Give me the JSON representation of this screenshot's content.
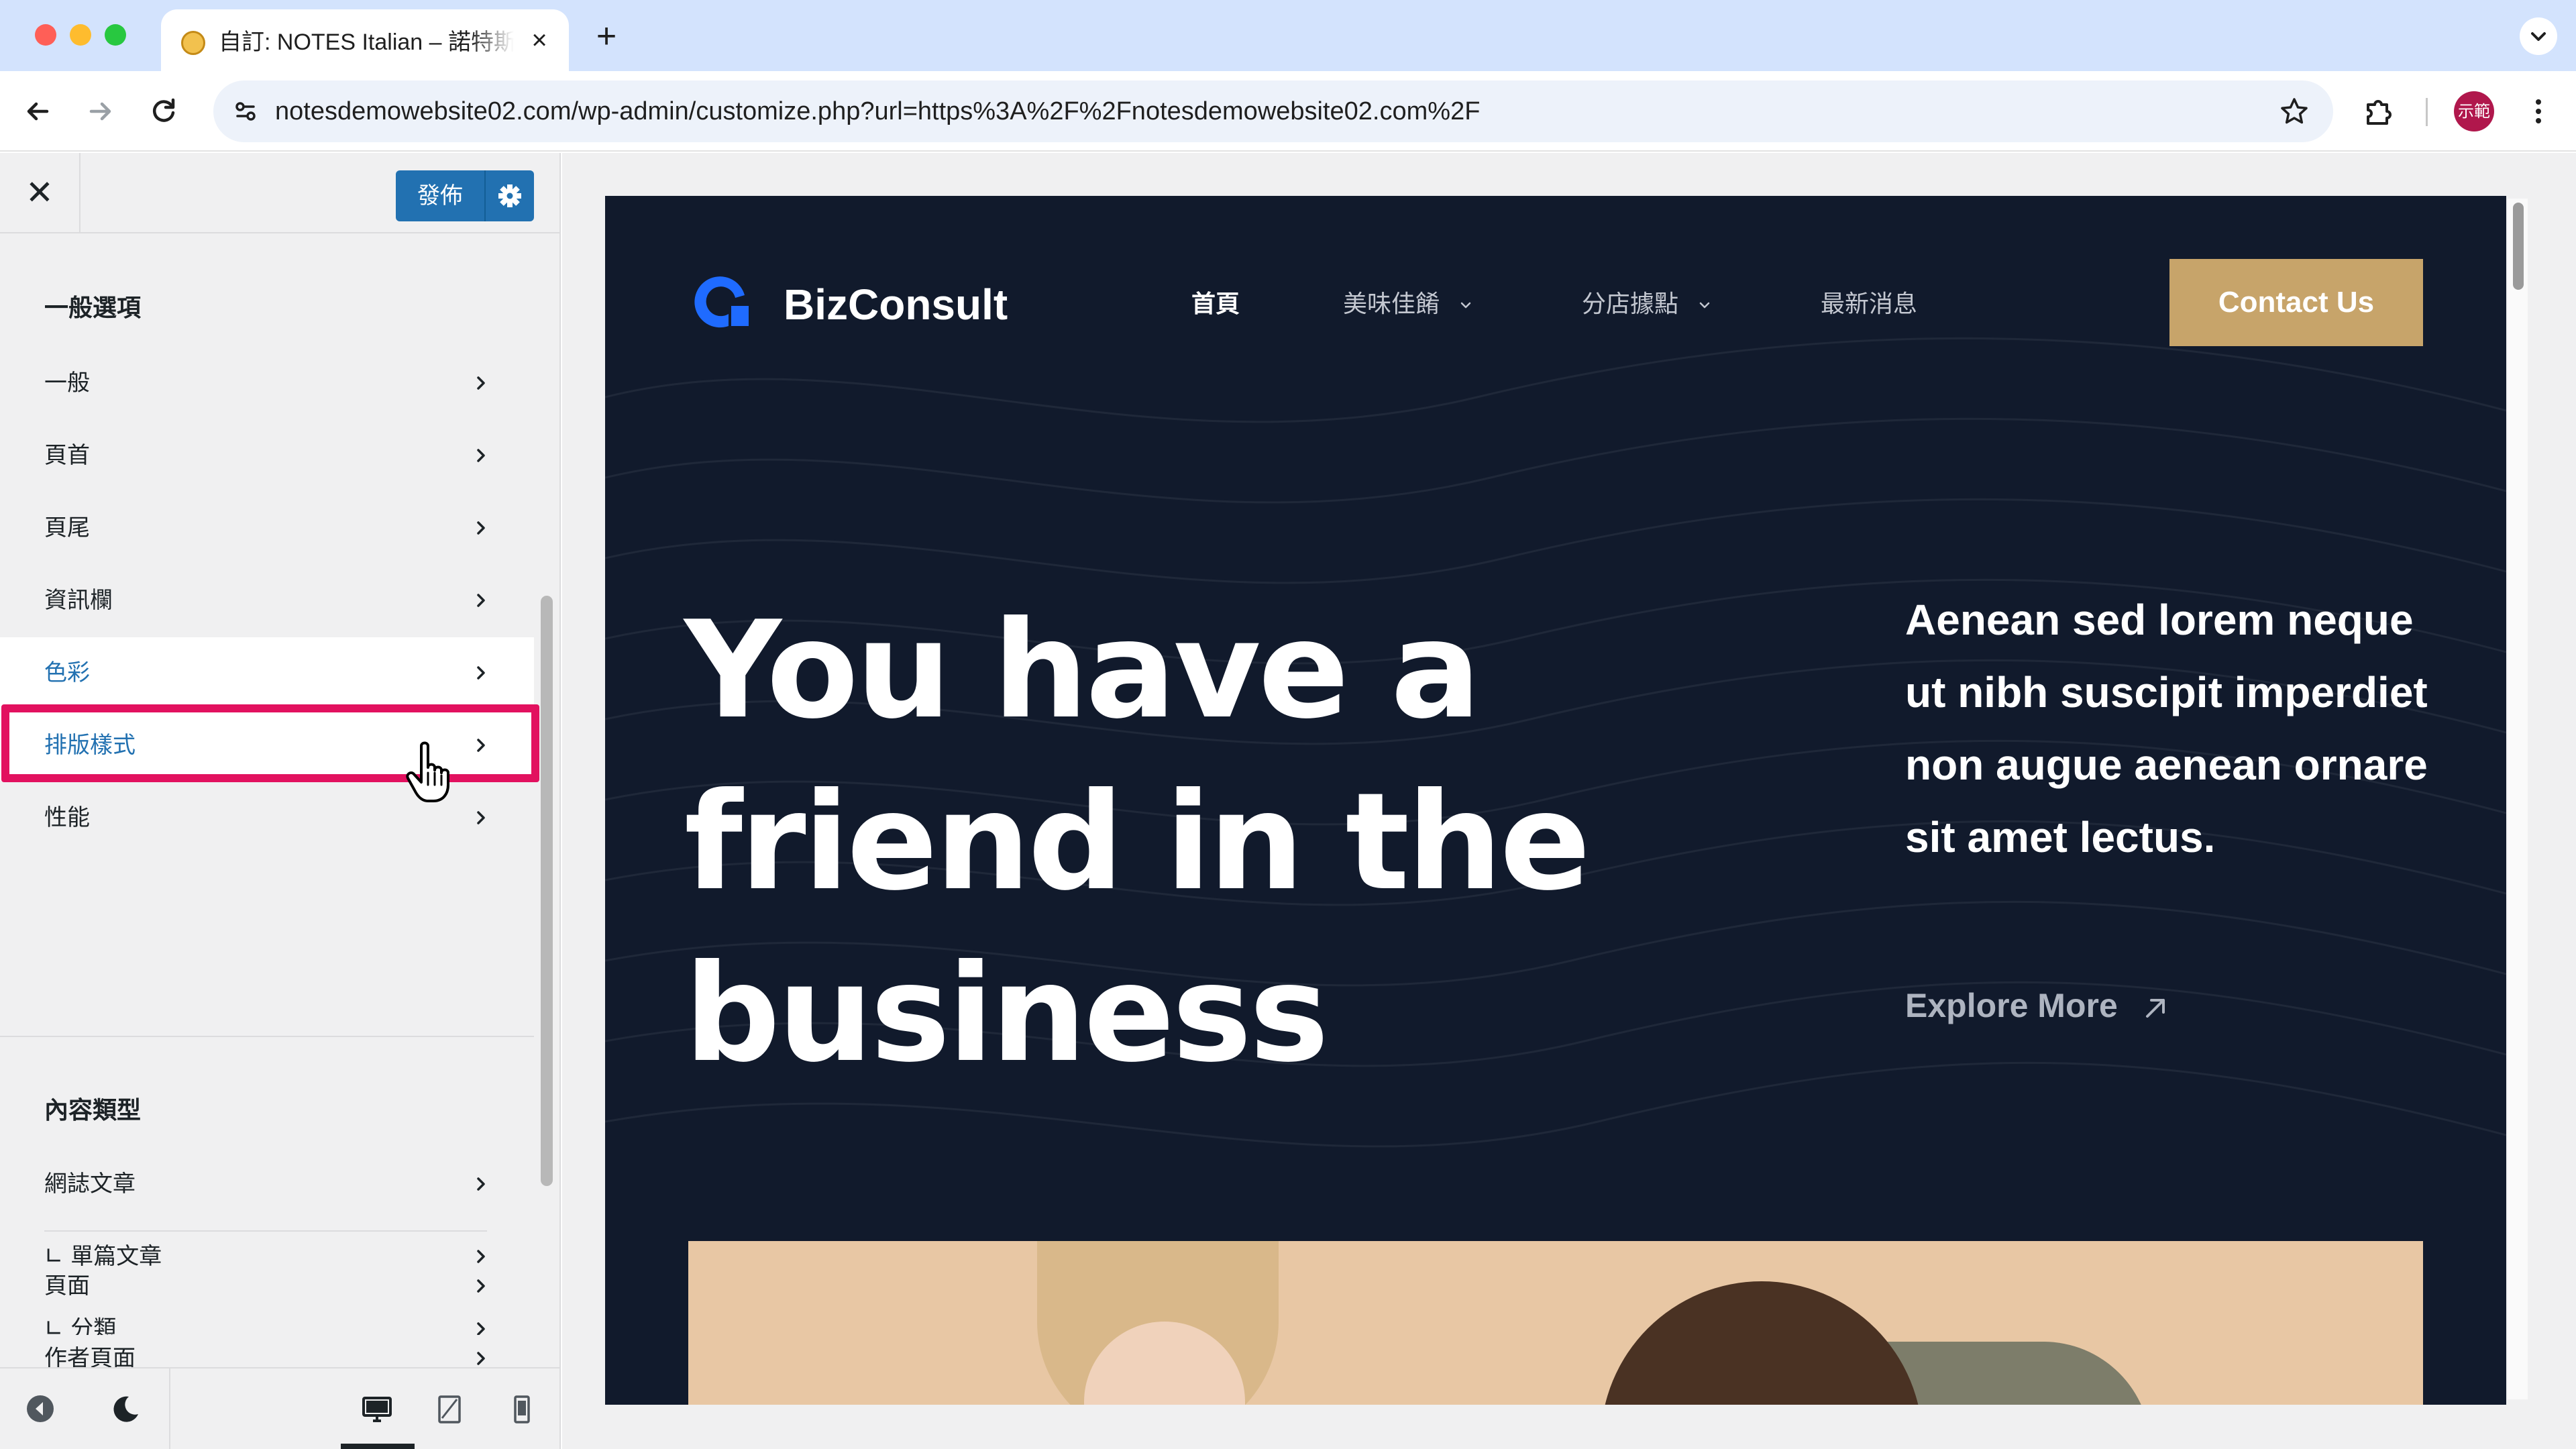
{
  "browser": {
    "tab_title": "自訂: NOTES Italian – 諾特斯義式",
    "url": "notesdemowebsite02.com/wp-admin/customize.php?url=https%3A%2F%2Fnotesdemowebsite02.com%2F",
    "profile_label": "示範"
  },
  "customizer": {
    "publish_label": "發佈",
    "sections": [
      {
        "title": "一般選項",
        "items": [
          "一般",
          "頁首",
          "頁尾",
          "資訊欄",
          "色彩",
          "排版樣式",
          "性能"
        ]
      },
      {
        "title": "內容類型",
        "items": [
          "網誌文章",
          "∟ 單篇文章",
          "∟ 分類",
          "頁面",
          "作者頁面"
        ]
      }
    ],
    "hovered_item": "色彩",
    "highlighted_item": "排版樣式"
  },
  "preview": {
    "logo_text": "BizConsult",
    "nav": [
      {
        "label": "首頁",
        "current": true,
        "dropdown": false
      },
      {
        "label": "美味佳餚",
        "current": false,
        "dropdown": true
      },
      {
        "label": "分店據點",
        "current": false,
        "dropdown": true
      },
      {
        "label": "最新消息",
        "current": false,
        "dropdown": false
      }
    ],
    "contact_label": "Contact Us",
    "hero_lines": [
      "You have a",
      "friend in the",
      "business"
    ],
    "hero_description": "Aenean sed lorem neque ut nibh suscipit imperdiet non augue aenean ornare sit amet lectus.",
    "explore_label": "Explore More"
  },
  "colors": {
    "wp_blue": "#2271b1",
    "highlight": "#e2115f",
    "preview_bg": "#111a2c",
    "accent_gold": "#c7a46a"
  }
}
